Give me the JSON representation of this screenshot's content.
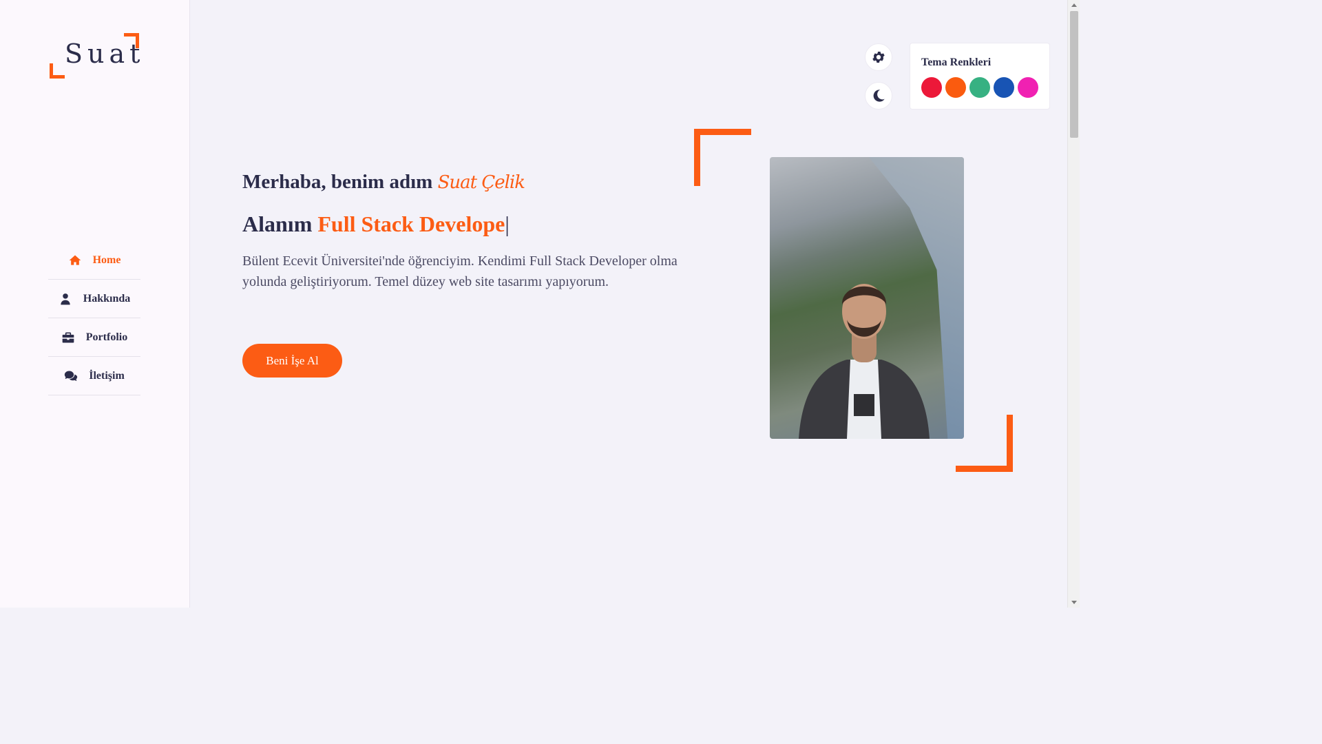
{
  "brand": {
    "logo_text": "Suat",
    "accent_color": "#fc5c14",
    "text_color": "#2b2c4a"
  },
  "nav": {
    "items": [
      {
        "label": "Home",
        "icon": "home-icon",
        "active": true
      },
      {
        "label": "Hakkında",
        "icon": "user-icon",
        "active": false
      },
      {
        "label": "Portfolio",
        "icon": "briefcase-icon",
        "active": false
      },
      {
        "label": "İletişim",
        "icon": "chat-icon",
        "active": false
      }
    ]
  },
  "controls": {
    "settings_icon": "gear-icon",
    "dark_mode_icon": "moon-icon"
  },
  "theme_panel": {
    "title": "Tema Renkleri",
    "colors": [
      "#ec1839",
      "#fa5b0f",
      "#37b182",
      "#1854b4",
      "#f021b2"
    ]
  },
  "hero": {
    "greeting": "Merhaba, benim adım",
    "name": "Suat Çelik",
    "role_prefix": "Alanım",
    "role_field": "Full Stack Develope",
    "cursor": "|",
    "bio": "Bülent Ecevit Üniversitei'nde öğrenciyim. Kendimi Full Stack Developer olma yolunda geliştiriyorum. Temel düzey web site tasarımı yapıyorum.",
    "cta_label": "Beni İşe Al"
  }
}
